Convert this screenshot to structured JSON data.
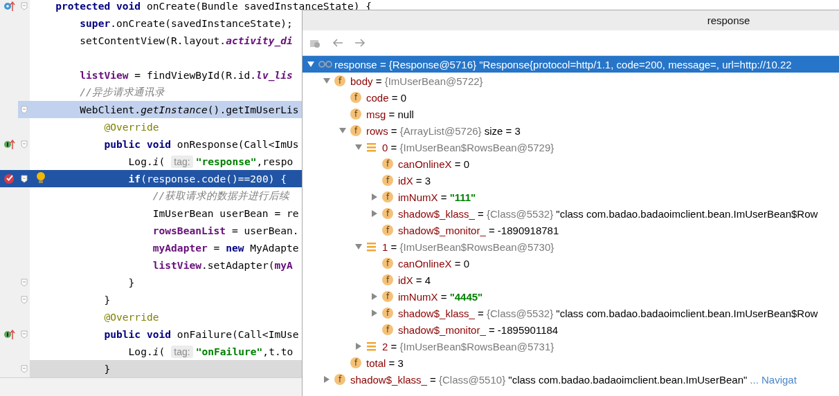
{
  "editor": {
    "lines": [
      {
        "kind": "override",
        "fold": true,
        "bulb": false,
        "selected": false,
        "execution": false,
        "caret": false,
        "tokens": [
          {
            "kind": "keyword",
            "text": "protected void "
          },
          {
            "kind": "plain",
            "text": "onCreate(Bundle savedInstanceState) {"
          }
        ],
        "children": [
          {
            "fold": false,
            "bulb": false,
            "selected": false,
            "execution": false,
            "caret": false,
            "tokens": [
              {
                "kind": "keyword",
                "text": "super"
              },
              {
                "kind": "plain",
                "text": ".onCreate(savedInstanceState);"
              }
            ]
          },
          {
            "fold": false,
            "bulb": false,
            "selected": false,
            "execution": false,
            "caret": false,
            "tokens": [
              {
                "kind": "plain",
                "text": "setContentView(R.layout."
              },
              {
                "kind": "static",
                "text": "activity_di"
              }
            ]
          },
          {
            "fold": false,
            "bulb": false,
            "selected": false,
            "execution": false,
            "caret": false
          },
          {
            "fold": false,
            "bulb": false,
            "selected": false,
            "execution": false,
            "caret": false,
            "tokens": [
              {
                "kind": "field",
                "text": "listView"
              },
              {
                "kind": "plain",
                "text": " = findViewById(R.id."
              },
              {
                "kind": "static",
                "text": "lv_lis"
              }
            ]
          },
          {
            "fold": false,
            "bulb": false,
            "selected": false,
            "execution": false,
            "caret": false,
            "tokens": [
              {
                "kind": "comment",
                "text": "//异步请求通讯录"
              }
            ]
          },
          {
            "fold": true,
            "bulb": false,
            "selected": true,
            "execution": false,
            "caret": false,
            "tokens": [
              {
                "kind": "plain",
                "text": "WebClient."
              },
              {
                "kind": "italic",
                "text": "getInstance"
              },
              {
                "kind": "plain",
                "text": "().getImUserLis"
              }
            ],
            "children": [
              {
                "fold": false,
                "bulb": false,
                "selected": false,
                "execution": false,
                "caret": false,
                "tokens": [
                  {
                    "kind": "annotation",
                    "text": "@Override"
                  }
                ]
              },
              {
                "kind": "implements",
                "fold": true,
                "bulb": false,
                "selected": false,
                "execution": false,
                "caret": false,
                "tokens": [
                  {
                    "kind": "keyword",
                    "text": "public void "
                  },
                  {
                    "kind": "plain",
                    "text": "onResponse(Call<ImUs"
                  }
                ],
                "children": [
                  {
                    "fold": false,
                    "bulb": false,
                    "selected": false,
                    "execution": false,
                    "caret": false,
                    "tokens": [
                      {
                        "kind": "plain",
                        "text": "Log."
                      },
                      {
                        "kind": "italic",
                        "text": "i"
                      },
                      {
                        "kind": "plain",
                        "text": "("
                      },
                      {
                        "kind": "hint",
                        "text": "tag:"
                      },
                      {
                        "kind": "string",
                        "text": "\"response\""
                      },
                      {
                        "kind": "plain",
                        "text": ",respo"
                      }
                    ]
                  },
                  {
                    "kind": "breakpoint",
                    "fold": true,
                    "bulb": true,
                    "selected": false,
                    "execution": true,
                    "caret": false,
                    "tokens": [
                      {
                        "kind": "keyword",
                        "text": "if"
                      },
                      {
                        "kind": "plain",
                        "text": "(response.code()==200) {"
                      }
                    ],
                    "children": [
                      {
                        "fold": false,
                        "bulb": false,
                        "selected": false,
                        "execution": false,
                        "caret": false,
                        "tokens": [
                          {
                            "kind": "comment",
                            "text": "//获取请求的数据并进行后续"
                          }
                        ]
                      },
                      {
                        "fold": false,
                        "bulb": false,
                        "selected": false,
                        "execution": false,
                        "caret": false,
                        "tokens": [
                          {
                            "kind": "plain",
                            "text": "ImUserBean userBean = re"
                          }
                        ]
                      },
                      {
                        "fold": false,
                        "bulb": false,
                        "selected": false,
                        "execution": false,
                        "caret": false,
                        "tokens": [
                          {
                            "kind": "field",
                            "text": "rowsBeanList"
                          },
                          {
                            "kind": "plain",
                            "text": " = userBean."
                          }
                        ]
                      },
                      {
                        "fold": false,
                        "bulb": false,
                        "selected": false,
                        "execution": false,
                        "caret": false,
                        "tokens": [
                          {
                            "kind": "field",
                            "text": "myAdapter"
                          },
                          {
                            "kind": "plain",
                            "text": " = "
                          },
                          {
                            "kind": "keyword",
                            "text": "new "
                          },
                          {
                            "kind": "plain",
                            "text": "MyAdapte"
                          }
                        ]
                      },
                      {
                        "fold": false,
                        "bulb": false,
                        "selected": false,
                        "execution": false,
                        "caret": false,
                        "tokens": [
                          {
                            "kind": "field",
                            "text": "listView"
                          },
                          {
                            "kind": "plain",
                            "text": ".setAdapter("
                          },
                          {
                            "kind": "field",
                            "text": "myA"
                          }
                        ]
                      }
                    ]
                  },
                  {
                    "fold": true,
                    "bulb": false,
                    "selected": false,
                    "execution": false,
                    "caret": false,
                    "tokens": [
                      {
                        "kind": "plain",
                        "text": "}"
                      }
                    ]
                  }
                ]
              },
              {
                "fold": true,
                "bulb": false,
                "selected": false,
                "execution": false,
                "caret": false,
                "tokens": [
                  {
                    "kind": "plain",
                    "text": "}"
                  }
                ]
              },
              {
                "fold": false,
                "bulb": false,
                "selected": false,
                "execution": false,
                "caret": false,
                "tokens": [
                  {
                    "kind": "annotation",
                    "text": "@Override"
                  }
                ]
              },
              {
                "kind": "implements",
                "fold": true,
                "bulb": false,
                "selected": false,
                "execution": false,
                "caret": false,
                "tokens": [
                  {
                    "kind": "keyword",
                    "text": "public void "
                  },
                  {
                    "kind": "plain",
                    "text": "onFailure(Call<ImUse"
                  }
                ],
                "children": [
                  {
                    "fold": false,
                    "bulb": false,
                    "selected": false,
                    "execution": false,
                    "caret": false,
                    "tokens": [
                      {
                        "kind": "plain",
                        "text": "Log."
                      },
                      {
                        "kind": "italic",
                        "text": "i"
                      },
                      {
                        "kind": "plain",
                        "text": "("
                      },
                      {
                        "kind": "hint",
                        "text": "tag:"
                      },
                      {
                        "kind": "string",
                        "text": "\"onFailure\""
                      },
                      {
                        "kind": "plain",
                        "text": ",t.to"
                      }
                    ]
                  }
                ]
              },
              {
                "fold": true,
                "bulb": false,
                "selected": false,
                "execution": false,
                "caret": true,
                "tokens": [
                  {
                    "kind": "plain",
                    "text": "}"
                  }
                ]
              }
            ]
          }
        ]
      }
    ]
  },
  "popup": {
    "title": "response",
    "tree": [
      {
        "kind": "watch",
        "name": "response",
        "sep": "=",
        "type": "{Response@5716}",
        "value": "\"Response{protocol=http/1.1, code=200, message=, url=http://10.22",
        "string_literal": false,
        "expanded": true,
        "selected": true,
        "children": [
          {
            "kind": "field",
            "icon_letter": "f",
            "name": "body",
            "sep": "=",
            "type": "{ImUserBean@5722}",
            "expanded": true,
            "selected": false,
            "children": [
              {
                "kind": "field",
                "icon_letter": "f",
                "name": "code",
                "sep": "=",
                "value": "0",
                "string_literal": false,
                "selected": false
              },
              {
                "kind": "field",
                "icon_letter": "f",
                "name": "msg",
                "sep": "=",
                "value": "null",
                "string_literal": false,
                "selected": false
              },
              {
                "kind": "field",
                "icon_letter": "f",
                "name": "rows",
                "sep": "=",
                "type": "{ArrayList@5726}",
                "value": "size = 3",
                "string_literal": false,
                "expanded": true,
                "selected": false,
                "children": [
                  {
                    "kind": "element",
                    "name": "0",
                    "sep": "=",
                    "type": "{ImUserBean$RowsBean@5729}",
                    "expanded": true,
                    "selected": false,
                    "children": [
                      {
                        "kind": "field",
                        "icon_letter": "f",
                        "name": "canOnlineX",
                        "sep": "=",
                        "value": "0",
                        "string_literal": false,
                        "selected": false
                      },
                      {
                        "kind": "field",
                        "icon_letter": "f",
                        "name": "idX",
                        "sep": "=",
                        "value": "3",
                        "string_literal": false,
                        "selected": false
                      },
                      {
                        "kind": "field",
                        "icon_letter": "f",
                        "name": "imNumX",
                        "sep": "=",
                        "value": "\"111\"",
                        "string_literal": true,
                        "expanded": false,
                        "selected": false
                      },
                      {
                        "kind": "field",
                        "icon_letter": "f",
                        "name": "shadow$_klass_",
                        "sep": "=",
                        "type": "{Class@5532}",
                        "value": "\"class com.badao.badaoimclient.bean.ImUserBean$Row",
                        "string_literal": false,
                        "expanded": false,
                        "selected": false
                      },
                      {
                        "kind": "field",
                        "icon_letter": "f",
                        "name": "shadow$_monitor_",
                        "sep": "=",
                        "value": "-1890918781",
                        "string_literal": false,
                        "selected": false
                      }
                    ]
                  },
                  {
                    "kind": "element",
                    "name": "1",
                    "sep": "=",
                    "type": "{ImUserBean$RowsBean@5730}",
                    "expanded": true,
                    "selected": false,
                    "children": [
                      {
                        "kind": "field",
                        "icon_letter": "f",
                        "name": "canOnlineX",
                        "sep": "=",
                        "value": "0",
                        "string_literal": false,
                        "selected": false
                      },
                      {
                        "kind": "field",
                        "icon_letter": "f",
                        "name": "idX",
                        "sep": "=",
                        "value": "4",
                        "string_literal": false,
                        "selected": false
                      },
                      {
                        "kind": "field",
                        "icon_letter": "f",
                        "name": "imNumX",
                        "sep": "=",
                        "value": "\"4445\"",
                        "string_literal": true,
                        "expanded": false,
                        "selected": false
                      },
                      {
                        "kind": "field",
                        "icon_letter": "f",
                        "name": "shadow$_klass_",
                        "sep": "=",
                        "type": "{Class@5532}",
                        "value": "\"class com.badao.badaoimclient.bean.ImUserBean$Row",
                        "string_literal": false,
                        "expanded": false,
                        "selected": false
                      },
                      {
                        "kind": "field",
                        "icon_letter": "f",
                        "name": "shadow$_monitor_",
                        "sep": "=",
                        "value": "-1895901184",
                        "string_literal": false,
                        "selected": false
                      }
                    ]
                  },
                  {
                    "kind": "element",
                    "name": "2",
                    "sep": "=",
                    "type": "{ImUserBean$RowsBean@5731}",
                    "expanded": false,
                    "selected": false
                  }
                ]
              },
              {
                "kind": "field",
                "icon_letter": "f",
                "name": "total",
                "sep": "=",
                "value": "3",
                "string_literal": false,
                "selected": false
              }
            ]
          },
          {
            "kind": "field",
            "icon_letter": "f",
            "name": "shadow$_klass_",
            "sep": "=",
            "type": "{Class@5510}",
            "value": "\"class com.badao.badaoimclient.bean.ImUserBean\"",
            "string_literal": false,
            "link": "... Navigat",
            "expanded": false,
            "selected": false
          }
        ]
      }
    ]
  }
}
